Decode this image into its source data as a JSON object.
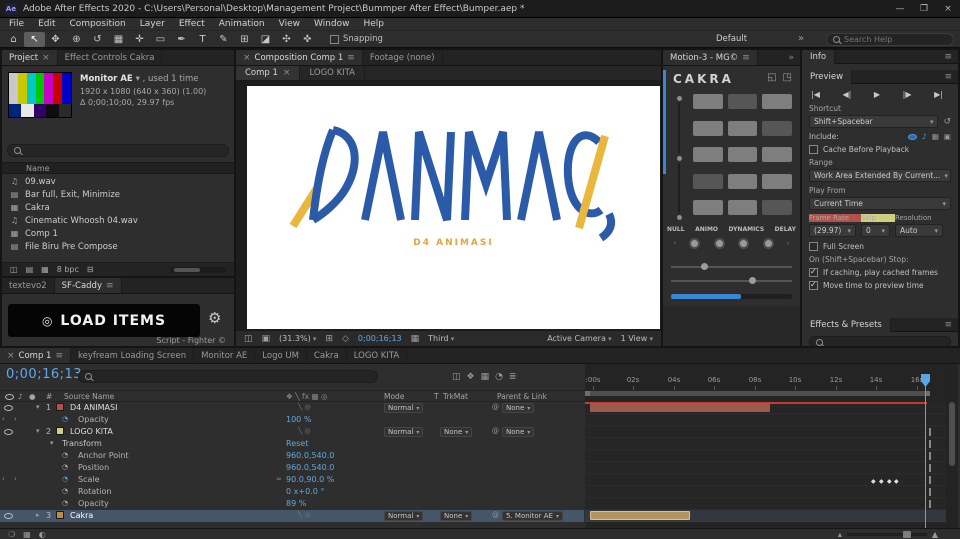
{
  "colors": {
    "accent": "#3f8fd6",
    "timecode": "#5fa8ea",
    "cache_bar": "#c6392e",
    "layer1_chip": "#b0524a",
    "layer2_chip": "#cfcf7f",
    "layer3_chip": "#c08a3e",
    "logo_blue": "#2b5ba8",
    "logo_yellow": "#e9b73d",
    "subtitle_orange": "#e8a33c"
  },
  "icons": {
    "app_badge": "Ae",
    "minimize": "—",
    "maximize": "❐",
    "close": "×",
    "menu": "≡",
    "chevrons": "»",
    "dropdown": "▾",
    "tools": {
      "home": "⌂",
      "selection": "↖",
      "hand": "✥",
      "zoom": "⊕",
      "orbit": "↺",
      "camera": "▦",
      "pan": "✛",
      "shape": "▭",
      "pen": "✒",
      "type": "T",
      "brush": "✎",
      "stamp": "⊞",
      "eraser": "◪",
      "roto": "✣",
      "puppet": "✜"
    },
    "audio_item": "♫",
    "folder_item": "▤",
    "comp_item": "▦",
    "gear": "⚙",
    "target": "◎",
    "trash": "⊟",
    "snapshot": "◫",
    "grid": "⊞",
    "mask": "◇",
    "camera3d": "▣",
    "region": "◱",
    "popout": "◳",
    "transport": {
      "first": "|◀",
      "prev": "◀|",
      "play": "▶",
      "next": "|▶",
      "last": "▶|"
    },
    "reset": "↺",
    "audio_include": "♪",
    "overlays": "▦",
    "solo": "●",
    "stopwatch": "◔",
    "link": "∞",
    "pickwhip": "@",
    "keyframe": "◆",
    "nav_prev": "‹",
    "nav_next": "›",
    "twirl_open": "▾",
    "twirl_closed": "▸",
    "shy": "❍",
    "blend": "▦",
    "motion_blur": "◐",
    "mountain_small": "▴",
    "mountain_large": "▲",
    "switches_header": "❖ ╲ fx ▦ ◎",
    "switches_row": "╲ ◎",
    "tl_icons": "◫❖▦◔≣"
  },
  "titlebar": {
    "title": "Adobe After Effects 2020 - C:\\Users\\Personal\\Desktop\\Management Project\\Bummper After Effect\\Bumper.aep *"
  },
  "menu": {
    "items": [
      "File",
      "Edit",
      "Composition",
      "Layer",
      "Effect",
      "Animation",
      "View",
      "Window",
      "Help"
    ]
  },
  "toolbar": {
    "snapping": "Snapping",
    "workspace": "Default",
    "search_placeholder": "Search Help"
  },
  "project": {
    "tab_project": "Project",
    "tab_effects": "Effect Controls Cakra",
    "preview_name": "Monitor AE",
    "preview_suffix": "▾ , used 1 time",
    "preview_dims": "1920 x 1080 (640 x 360) (1.00)",
    "preview_time": "Δ 0;00;10;00, 29.97 fps",
    "col_name": "Name",
    "items": [
      {
        "label": "09.wav"
      },
      {
        "label": "Bar full, Exit, Minimize"
      },
      {
        "label": "Cakra"
      },
      {
        "label": "Cinematic Whoosh 04.wav"
      },
      {
        "label": "Comp 1"
      },
      {
        "label": "File Biru Pre Compose"
      }
    ],
    "bpc": "8 bpc"
  },
  "script_panel": {
    "tab1": "textevo2",
    "tab2": "SF-Caddy",
    "load_label": "LOAD ITEMS",
    "credit": "Script - Fighter ©"
  },
  "comp": {
    "tab": "Composition Comp 1",
    "tab_footage": "Footage (none)",
    "subtab1": "Comp 1",
    "subtab2": "LOGO KITA",
    "subtitle": "D4 ANIMASI",
    "zoom": "(31.3%)",
    "time": "0;00;16;13",
    "quality": "Third",
    "camera": "Active Camera",
    "view": "1 View"
  },
  "motion": {
    "tab": "Motion-3 - MG©",
    "brand": "CAKRA",
    "b1": "NULL",
    "b2": "ANIMO",
    "b3": "DYNAMICS",
    "b4": "DELAY"
  },
  "info": {
    "title": "Info"
  },
  "preview": {
    "title": "Preview",
    "shortcut_label": "Shortcut",
    "shortcut": "Shift+Spacebar",
    "include_label": "Include:",
    "cache": "Cache Before Playback",
    "range_label": "Range",
    "range": "Work Area Extended By Current...",
    "playfrom_label": "Play From",
    "playfrom": "Current Time",
    "framerate_label": "Frame Rate",
    "skip_label": "Skip",
    "resolution_label": "Resolution",
    "framerate": "(29.97)",
    "skip": "0",
    "resolution": "Auto",
    "fullscreen": "Full Screen",
    "stop_label": "On (Shift+Spacebar) Stop:",
    "opt1": "If caching, play cached frames",
    "opt2": "Move time to preview time"
  },
  "effects": {
    "title": "Effects & Presets"
  },
  "timeline": {
    "tabs": [
      "Comp 1",
      "keyfream Loading Screen",
      "Monitor AE",
      "Logo UM",
      "Cakra",
      "LOGO KITA"
    ],
    "time": "0;00;16;13",
    "head_source": "Source Name",
    "head_mode": "Mode",
    "head_t": "T",
    "head_trkmat": "TrkMat",
    "head_parent": "Parent & Link",
    "ruler": [
      ":00s",
      "02s",
      "04s",
      "06s",
      "08s",
      "10s",
      "12s",
      "14s",
      "16s"
    ],
    "layers": [
      {
        "num": "1",
        "name": "D4 ANIMASI",
        "mode": "Normal",
        "parent": "None"
      },
      {
        "num": "2",
        "name": "LOGO KITA",
        "mode": "Normal",
        "trkmat": "None",
        "parent": "None"
      },
      {
        "num": "3",
        "name": "Cakra",
        "mode": "Normal",
        "trkmat": "None",
        "parent": "5. Monitor AE"
      }
    ],
    "props": {
      "opacity1": {
        "label": "Opacity",
        "value": "100 %"
      },
      "transform": {
        "label": "Transform",
        "value": "Reset"
      },
      "anchor": {
        "label": "Anchor Point",
        "value": "960.0,540.0"
      },
      "position": {
        "label": "Position",
        "value": "960.0,540.0"
      },
      "scale": {
        "label": "Scale",
        "value": "90.0,90.0 %"
      },
      "rotation": {
        "label": "Rotation",
        "value": "0 x+0.0 °"
      },
      "opacity2": {
        "label": "Opacity",
        "value": "89 %"
      }
    }
  }
}
